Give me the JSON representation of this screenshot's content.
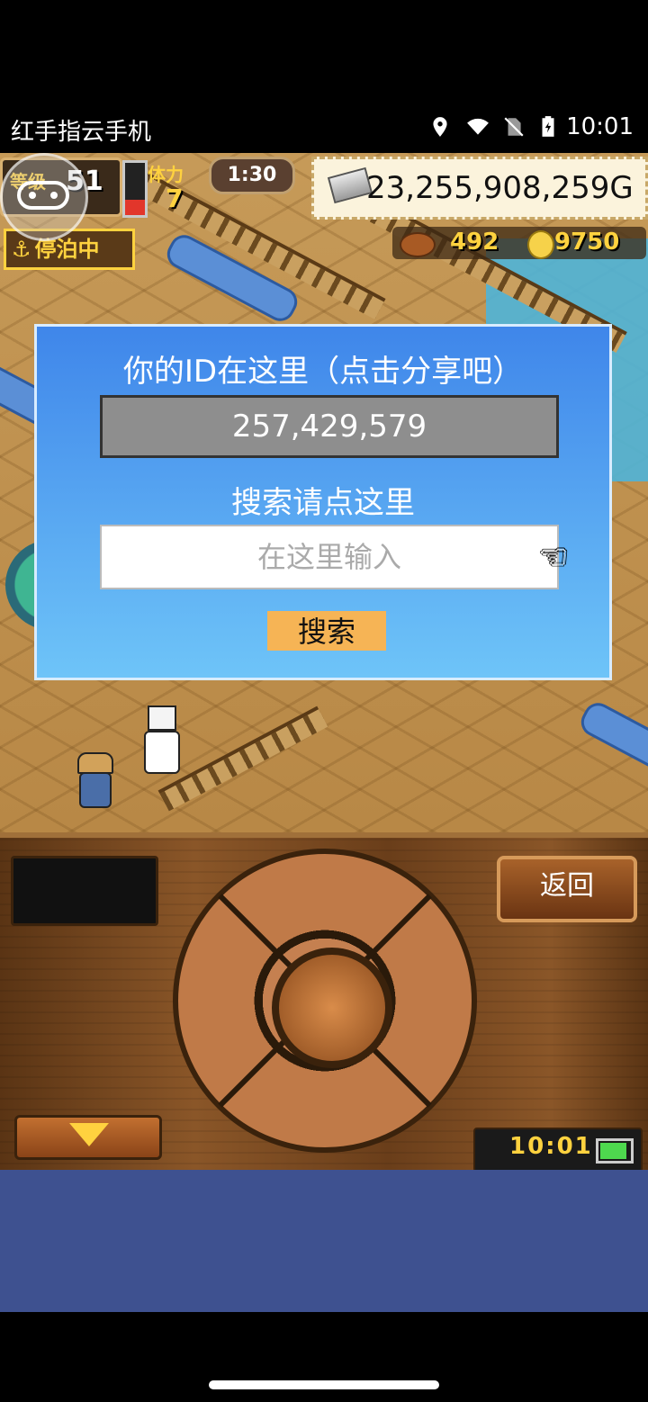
{
  "status_bar": {
    "carrier": "红手指云手机",
    "time": "10:01",
    "icons": [
      "location-icon",
      "wifi-icon",
      "no-sim-icon",
      "battery-charging-icon"
    ]
  },
  "hud": {
    "level_label": "等级",
    "level_value": "51",
    "stamina_label": "体力",
    "stamina_value": "7",
    "stamina_fill_fraction": 0.3,
    "timer": "1:30",
    "gold": "23,255,908,259G",
    "docked_status": "停泊中",
    "fish_count": "492",
    "medal_count": "9750"
  },
  "dialog": {
    "title": "你的ID在这里（点击分享吧）",
    "id_value": "257,429,579",
    "search_label": "搜索请点这里",
    "search_placeholder": "在这里输入",
    "search_button": "搜索"
  },
  "panel": {
    "back_button": "返回",
    "clock": "10:01",
    "battery_fraction": 0.8
  },
  "colors": {
    "dialog_top": "#3f86ea",
    "dialog_bottom": "#6ec4f8",
    "search_button": "#f6b455",
    "hud_gold": "#ffd23f",
    "bottom_area": "#3e5190"
  }
}
